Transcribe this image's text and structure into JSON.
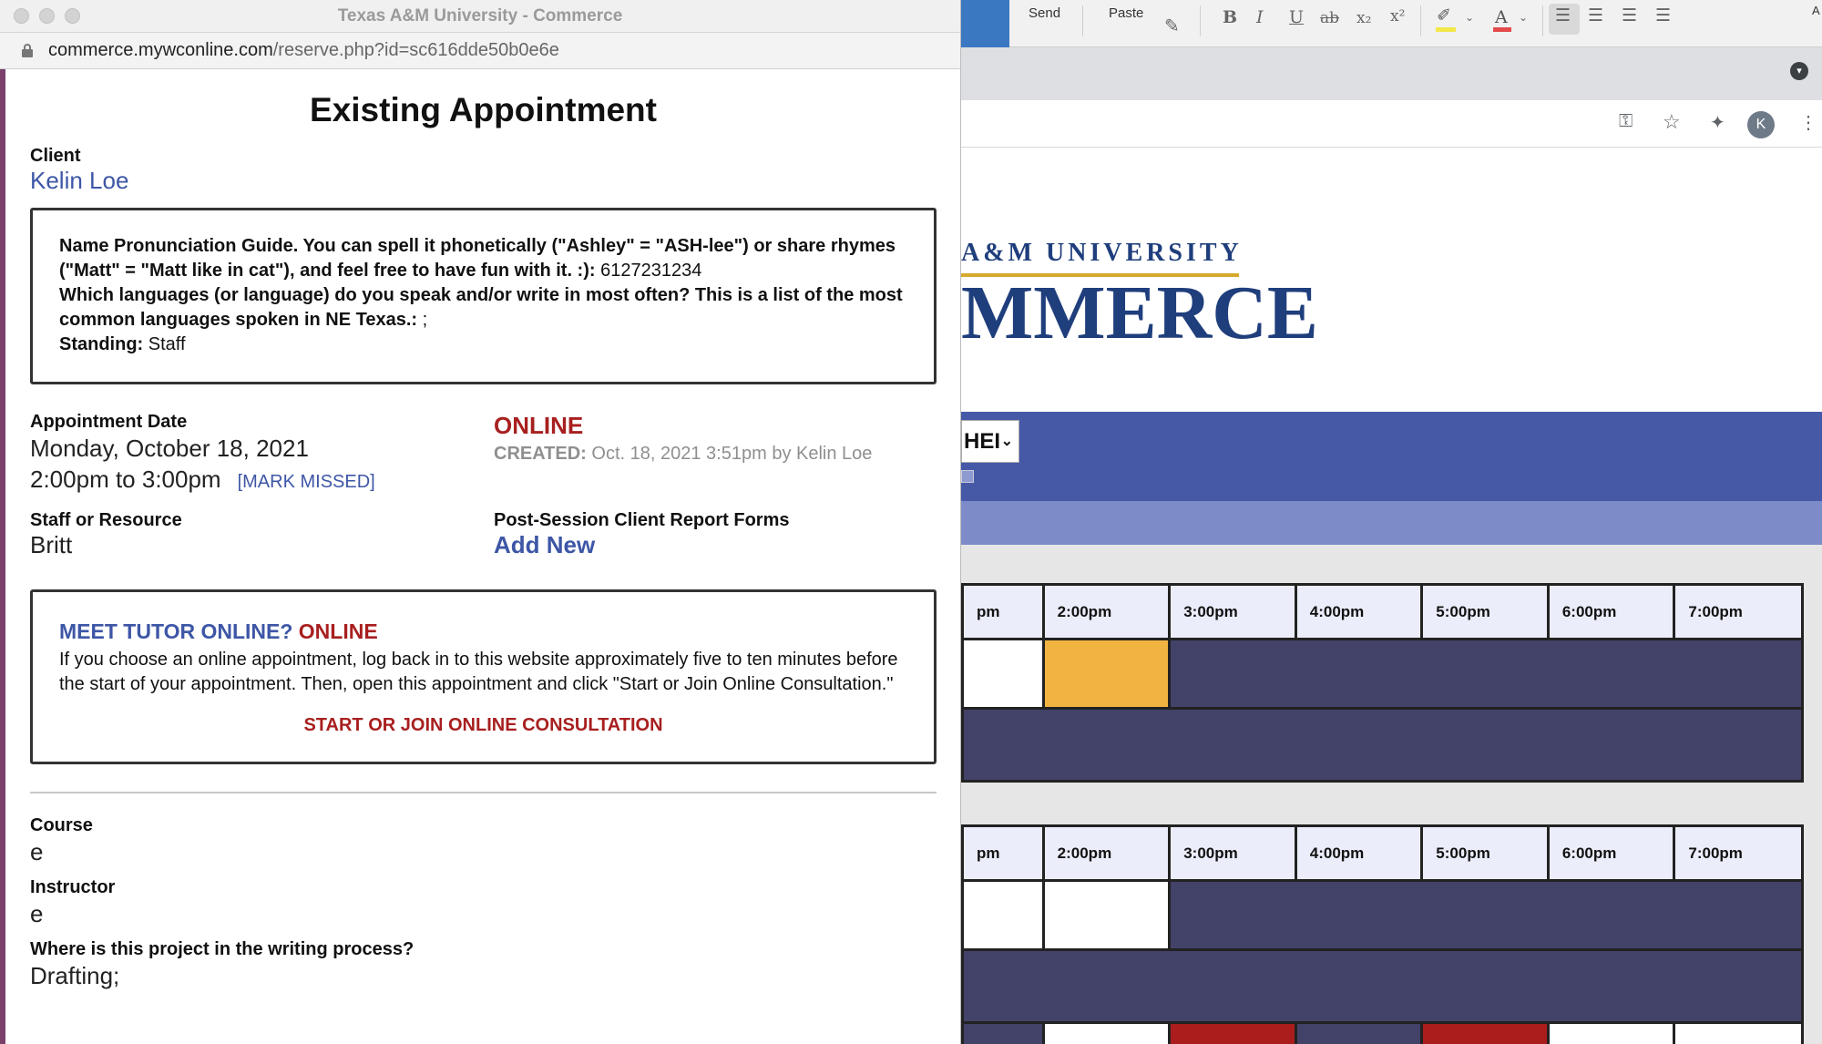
{
  "popup": {
    "window_title": "Texas A&M University - Commerce",
    "url_host": "commerce.mywconline.com",
    "url_path": "/reserve.php?id=sc616dde50b0e6e",
    "heading": "Existing Appointment",
    "client": {
      "label": "Client",
      "name": "Kelin Loe"
    },
    "info_box": {
      "pronunciation_q": "Name Pronunciation Guide. You can spell it phonetically (\"Ashley\" = \"ASH-lee\") or share rhymes (\"Matt\" = \"Matt like in cat\"), and feel free to have fun with it. :):",
      "pronunciation_a": "6127231234",
      "language_q": "Which languages (or language) do you speak and/or write in most often? This is a list of the most common languages spoken in NE Texas.:",
      "language_a": ";",
      "standing_label": "Standing:",
      "standing_value": "Staff"
    },
    "appointment": {
      "date_label": "Appointment Date",
      "date": "Monday, October 18, 2021",
      "time": "2:00pm to 3:00pm",
      "mark_missed": "[MARK MISSED]",
      "mode": "ONLINE",
      "created_label": "CREATED:",
      "created_value": "Oct. 18, 2021 3:51pm by Kelin Loe",
      "staff_label": "Staff or Resource",
      "staff_value": "Britt",
      "forms_label": "Post-Session Client Report Forms",
      "forms_link": "Add New"
    },
    "meet": {
      "title": "MEET TUTOR ONLINE?",
      "title_value": "ONLINE",
      "body": "If you choose an online appointment, log back in to this website approximately five to ten minutes before the start of your appointment. Then, open this appointment and click \"Start or Join Online Consultation.\"",
      "start_link": "START OR JOIN ONLINE CONSULTATION"
    },
    "fields": [
      {
        "label": "Course",
        "value": "e"
      },
      {
        "label": "Instructor",
        "value": "e"
      },
      {
        "label": "Where is this project in the writing process?",
        "value": "Drafting;"
      }
    ]
  },
  "word_toolbar": {
    "send": "Send",
    "paste": "Paste",
    "bold": "B",
    "italic": "I",
    "underline": "U",
    "strikethrough": "ab",
    "subscript": "x₂",
    "superscript": "x²",
    "font_color": "A",
    "corner": "A"
  },
  "background_page": {
    "logo_top": "A&M UNIVERSITY",
    "logo_main": "MMERCE",
    "select_value": "HEI",
    "avatar_letter": "K",
    "schedule_headers": [
      "pm",
      "2:00pm",
      "3:00pm",
      "4:00pm",
      "5:00pm",
      "6:00pm",
      "7:00pm"
    ]
  },
  "colors": {
    "brand_blue": "#3d56a6",
    "alert_red": "#a81f1f",
    "band_blue": "#4559a7",
    "booked_navy": "#434268",
    "own_appt_yellow": "#f2b441"
  }
}
